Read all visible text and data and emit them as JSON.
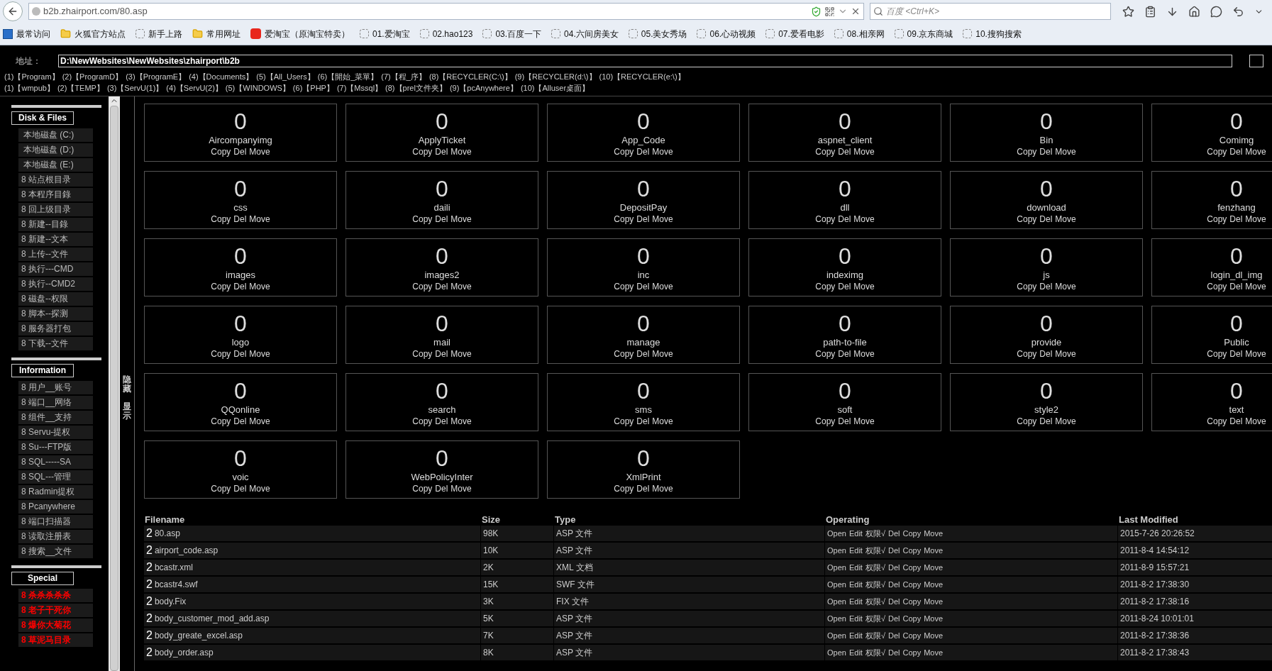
{
  "browser": {
    "url": "b2b.zhairport.com/80.asp",
    "search_placeholder": "百度 <Ctrl+K>",
    "bookmarks": [
      {
        "kind": "frequent",
        "label": "最常访问"
      },
      {
        "kind": "folder",
        "label": "火狐官方站点"
      },
      {
        "kind": "page",
        "label": "新手上路"
      },
      {
        "kind": "folder",
        "label": "常用网址"
      },
      {
        "kind": "taobao",
        "label": "爱淘宝（原淘宝特卖）"
      },
      {
        "kind": "page",
        "label": "01.爱淘宝"
      },
      {
        "kind": "page",
        "label": "02.hao123"
      },
      {
        "kind": "page",
        "label": "03.百度一下"
      },
      {
        "kind": "page",
        "label": "04.六间房美女"
      },
      {
        "kind": "page",
        "label": "05.美女秀场"
      },
      {
        "kind": "page",
        "label": "06.心动视频"
      },
      {
        "kind": "page",
        "label": "07.爱看电影"
      },
      {
        "kind": "page",
        "label": "08.相亲网"
      },
      {
        "kind": "page",
        "label": "09.京东商城"
      },
      {
        "kind": "page",
        "label": "10.搜狗搜索"
      }
    ]
  },
  "address": {
    "label": "地址：",
    "value": "D:\\NewWebsites\\NewWebsites\\zhairport\\b2b"
  },
  "quick_links": [
    [
      "(1)【Program】",
      "(2)【ProgramD】",
      "(3)【ProgramE】",
      "(4)【Documents】",
      "(5)【All_Users】",
      "(6)【開始_菜單】",
      "(7)【程_序】",
      "(8)【RECYCLER(C:\\)】",
      "(9)【RECYCLER(d:\\)】",
      "(10)【RECYCLER(e:\\)】"
    ],
    [
      "(1)【wmpub】",
      "(2)【TEMP】",
      "(3)【ServU(1)】",
      "(4)【ServU(2)】",
      "(5)【WINDOWS】",
      "(6)【PHP】",
      "(7)【Mssql】",
      "(8)【prel文件夹】",
      "(9)【pcAnywhere】",
      "(10)【Alluser桌面】"
    ]
  ],
  "sidebar": {
    "toggle": [
      "隐藏",
      "显示"
    ],
    "sections": [
      {
        "title": "Disk & Files",
        "items": [
          {
            "kind": "disk",
            "label": "本地磁盘 (C:)"
          },
          {
            "kind": "disk",
            "label": "本地磁盘 (D:)"
          },
          {
            "kind": "disk",
            "label": "本地磁盘 (E:)"
          },
          {
            "kind": "tool",
            "label": "8 站点根目录"
          },
          {
            "kind": "tool",
            "label": "8 本程序目錄"
          },
          {
            "kind": "tool",
            "label": "8 回上级目录"
          },
          {
            "kind": "tool",
            "label": "8 新建--目錄"
          },
          {
            "kind": "tool",
            "label": "8 新建--文本"
          },
          {
            "kind": "tool",
            "label": "8 上传--文件"
          },
          {
            "kind": "tool",
            "label": "8 执行---CMD"
          },
          {
            "kind": "tool",
            "label": "8 执行--CMD2"
          },
          {
            "kind": "tool",
            "label": "8 磁盘--权限"
          },
          {
            "kind": "tool",
            "label": "8 脚本--探测"
          },
          {
            "kind": "tool",
            "label": "8 服务器打包"
          },
          {
            "kind": "tool",
            "label": "8 下载--文件"
          }
        ]
      },
      {
        "title": "Information",
        "items": [
          {
            "kind": "tool",
            "label": "8 用户__账号"
          },
          {
            "kind": "tool",
            "label": "8 端口__网络"
          },
          {
            "kind": "tool",
            "label": "8 组件__支持"
          },
          {
            "kind": "tool",
            "label": "8 Servu-提权"
          },
          {
            "kind": "tool",
            "label": "8 Su---FTP版"
          },
          {
            "kind": "tool",
            "label": "8 SQL-----SA"
          },
          {
            "kind": "tool",
            "label": "8 SQL---管理"
          },
          {
            "kind": "tool",
            "label": "8 Radmin提权"
          },
          {
            "kind": "tool",
            "label": "8 Pcanywhere"
          },
          {
            "kind": "tool",
            "label": "8 端口扫描器"
          },
          {
            "kind": "tool",
            "label": "8 读取注册表"
          },
          {
            "kind": "tool",
            "label": "8 搜索__文件"
          }
        ]
      },
      {
        "title": "Special",
        "items": [
          {
            "kind": "danger",
            "label": "8 杀杀杀杀杀"
          },
          {
            "kind": "danger",
            "label": "8 老子干死你"
          },
          {
            "kind": "danger",
            "label": "8 爆你大菊花"
          },
          {
            "kind": "danger",
            "label": "8 草泥马目录"
          }
        ]
      }
    ]
  },
  "folders": [
    {
      "count": "0",
      "name": "Aircompanyimg",
      "actions": [
        "Copy",
        "Del",
        "Move"
      ]
    },
    {
      "count": "0",
      "name": "ApplyTicket",
      "actions": [
        "Copy",
        "Del",
        "Move"
      ]
    },
    {
      "count": "0",
      "name": "App_Code",
      "actions": [
        "Copy",
        "Del",
        "Move"
      ]
    },
    {
      "count": "0",
      "name": "aspnet_client",
      "actions": [
        "Copy",
        "Del",
        "Move"
      ]
    },
    {
      "count": "0",
      "name": "Bin",
      "actions": [
        "Copy",
        "Del",
        "Move"
      ]
    },
    {
      "count": "0",
      "name": "Comimg",
      "actions": [
        "Copy",
        "Del",
        "Move"
      ]
    },
    {
      "count": "0",
      "name": "css",
      "actions": [
        "Copy",
        "Del",
        "Move"
      ]
    },
    {
      "count": "0",
      "name": "daili",
      "actions": [
        "Copy",
        "Del",
        "Move"
      ]
    },
    {
      "count": "0",
      "name": "DepositPay",
      "actions": [
        "Copy",
        "Del",
        "Move"
      ]
    },
    {
      "count": "0",
      "name": "dll",
      "actions": [
        "Copy",
        "Del",
        "Move"
      ]
    },
    {
      "count": "0",
      "name": "download",
      "actions": [
        "Copy",
        "Del",
        "Move"
      ]
    },
    {
      "count": "0",
      "name": "fenzhang",
      "actions": [
        "Copy",
        "Del",
        "Move"
      ]
    },
    {
      "count": "0",
      "name": "images",
      "actions": [
        "Copy",
        "Del",
        "Move"
      ]
    },
    {
      "count": "0",
      "name": "images2",
      "actions": [
        "Copy",
        "Del",
        "Move"
      ]
    },
    {
      "count": "0",
      "name": "inc",
      "actions": [
        "Copy",
        "Del",
        "Move"
      ]
    },
    {
      "count": "0",
      "name": "indeximg",
      "actions": [
        "Copy",
        "Del",
        "Move"
      ]
    },
    {
      "count": "0",
      "name": "js",
      "actions": [
        "Copy",
        "Del",
        "Move"
      ]
    },
    {
      "count": "0",
      "name": "login_dl_img",
      "actions": [
        "Copy",
        "Del",
        "Move"
      ]
    },
    {
      "count": "0",
      "name": "logo",
      "actions": [
        "Copy",
        "Del",
        "Move"
      ]
    },
    {
      "count": "0",
      "name": "mail",
      "actions": [
        "Copy",
        "Del",
        "Move"
      ]
    },
    {
      "count": "0",
      "name": "manage",
      "actions": [
        "Copy",
        "Del",
        "Move"
      ]
    },
    {
      "count": "0",
      "name": "path-to-file",
      "actions": [
        "Copy",
        "Del",
        "Move"
      ]
    },
    {
      "count": "0",
      "name": "provide",
      "actions": [
        "Copy",
        "Del",
        "Move"
      ]
    },
    {
      "count": "0",
      "name": "Public",
      "actions": [
        "Copy",
        "Del",
        "Move"
      ]
    },
    {
      "count": "0",
      "name": "QQonline",
      "actions": [
        "Copy",
        "Del",
        "Move"
      ]
    },
    {
      "count": "0",
      "name": "search",
      "actions": [
        "Copy",
        "Del",
        "Move"
      ]
    },
    {
      "count": "0",
      "name": "sms",
      "actions": [
        "Copy",
        "Del",
        "Move"
      ]
    },
    {
      "count": "0",
      "name": "soft",
      "actions": [
        "Copy",
        "Del",
        "Move"
      ]
    },
    {
      "count": "0",
      "name": "style2",
      "actions": [
        "Copy",
        "Del",
        "Move"
      ]
    },
    {
      "count": "0",
      "name": "text",
      "actions": [
        "Copy",
        "Del",
        "Move"
      ]
    },
    {
      "count": "0",
      "name": "voic",
      "actions": [
        "Copy",
        "Del",
        "Move"
      ]
    },
    {
      "count": "0",
      "name": "WebPolicyInter",
      "actions": [
        "Copy",
        "Del",
        "Move"
      ]
    },
    {
      "count": "0",
      "name": "XmlPrint",
      "actions": [
        "Copy",
        "Del",
        "Move"
      ]
    }
  ],
  "files": {
    "columns": [
      "Filename",
      "Size",
      "Type",
      "Operating",
      "Last Modified"
    ],
    "rows": [
      {
        "glyph": "2",
        "name": "80.asp",
        "size": "98K",
        "type": "ASP 文件",
        "ops": [
          "Open",
          "Edit",
          "权限√",
          "Del",
          "Copy",
          "Move"
        ],
        "modified": "2015-7-26 20:26:52"
      },
      {
        "glyph": "2",
        "name": "airport_code.asp",
        "size": "10K",
        "type": "ASP 文件",
        "ops": [
          "Open",
          "Edit",
          "权限√",
          "Del",
          "Copy",
          "Move"
        ],
        "modified": "2011-8-4 14:54:12"
      },
      {
        "glyph": "2",
        "name": "bcastr.xml",
        "size": "2K",
        "type": "XML 文档",
        "ops": [
          "Open",
          "Edit",
          "权限√",
          "Del",
          "Copy",
          "Move"
        ],
        "modified": "2011-8-9 15:57:21"
      },
      {
        "glyph": "2",
        "name": "bcastr4.swf",
        "size": "15K",
        "type": "SWF 文件",
        "ops": [
          "Open",
          "Edit",
          "权限√",
          "Del",
          "Copy",
          "Move"
        ],
        "modified": "2011-8-2 17:38:30"
      },
      {
        "glyph": "2",
        "name": "body.Fix",
        "size": "3K",
        "type": "FIX 文件",
        "ops": [
          "Open",
          "Edit",
          "权限√",
          "Del",
          "Copy",
          "Move"
        ],
        "modified": "2011-8-2 17:38:16"
      },
      {
        "glyph": "2",
        "name": "body_customer_mod_add.asp",
        "size": "5K",
        "type": "ASP 文件",
        "ops": [
          "Open",
          "Edit",
          "权限√",
          "Del",
          "Copy",
          "Move"
        ],
        "modified": "2011-8-24 10:01:01"
      },
      {
        "glyph": "2",
        "name": "body_greate_excel.asp",
        "size": "7K",
        "type": "ASP 文件",
        "ops": [
          "Open",
          "Edit",
          "权限√",
          "Del",
          "Copy",
          "Move"
        ],
        "modified": "2011-8-2 17:38:36"
      },
      {
        "glyph": "2",
        "name": "body_order.asp",
        "size": "8K",
        "type": "ASP 文件",
        "ops": [
          "Open",
          "Edit",
          "权限√",
          "Del",
          "Copy",
          "Move"
        ],
        "modified": "2011-8-2 17:38:43"
      }
    ]
  }
}
